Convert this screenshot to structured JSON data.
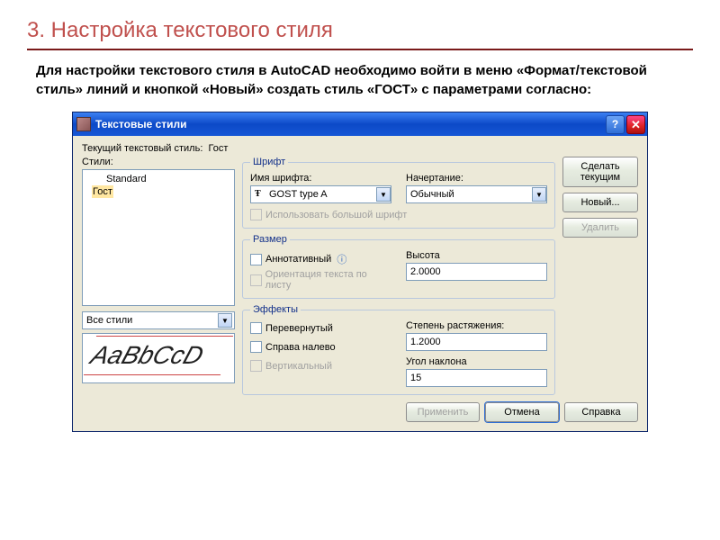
{
  "slide": {
    "title": "3. Настройка текстового стиля",
    "paragraph": "Для настройки текстового стиля в AutoCAD необходимо войти в меню «Формат/текстовой стиль» линий и кнопкой «Новый» создать стиль «ГОСТ» с параметрами согласно:"
  },
  "dialog": {
    "title": "Текстовые стили",
    "status_label": "Текущий текстовый стиль:",
    "status_value": "Гост",
    "styles_label": "Стили:",
    "styles": {
      "item0": "Standard",
      "item1": "Гост"
    },
    "filter_value": "Все стили",
    "preview_sample": "AaBbCcD",
    "groups": {
      "font": {
        "legend": "Шрифт",
        "name_label": "Имя шрифта:",
        "name_value": "GOST type A",
        "style_label": "Начертание:",
        "style_value": "Обычный",
        "bigfont_label": "Использовать большой шрифт"
      },
      "size": {
        "legend": "Размер",
        "annotative_label": "Аннотативный",
        "orient_label": "Ориентация текста по листу",
        "height_label": "Высота",
        "height_value": "2.0000"
      },
      "effects": {
        "legend": "Эффекты",
        "upside_label": "Перевернутый",
        "backwards_label": "Справа налево",
        "vertical_label": "Вертикальный",
        "width_label": "Степень растяжения:",
        "width_value": "1.2000",
        "oblique_label": "Угол наклона",
        "oblique_value": "15"
      }
    },
    "buttons": {
      "set_current": "Сделать текущим",
      "new": "Новый...",
      "delete": "Удалить",
      "apply": "Применить",
      "cancel": "Отмена",
      "help": "Справка"
    }
  }
}
